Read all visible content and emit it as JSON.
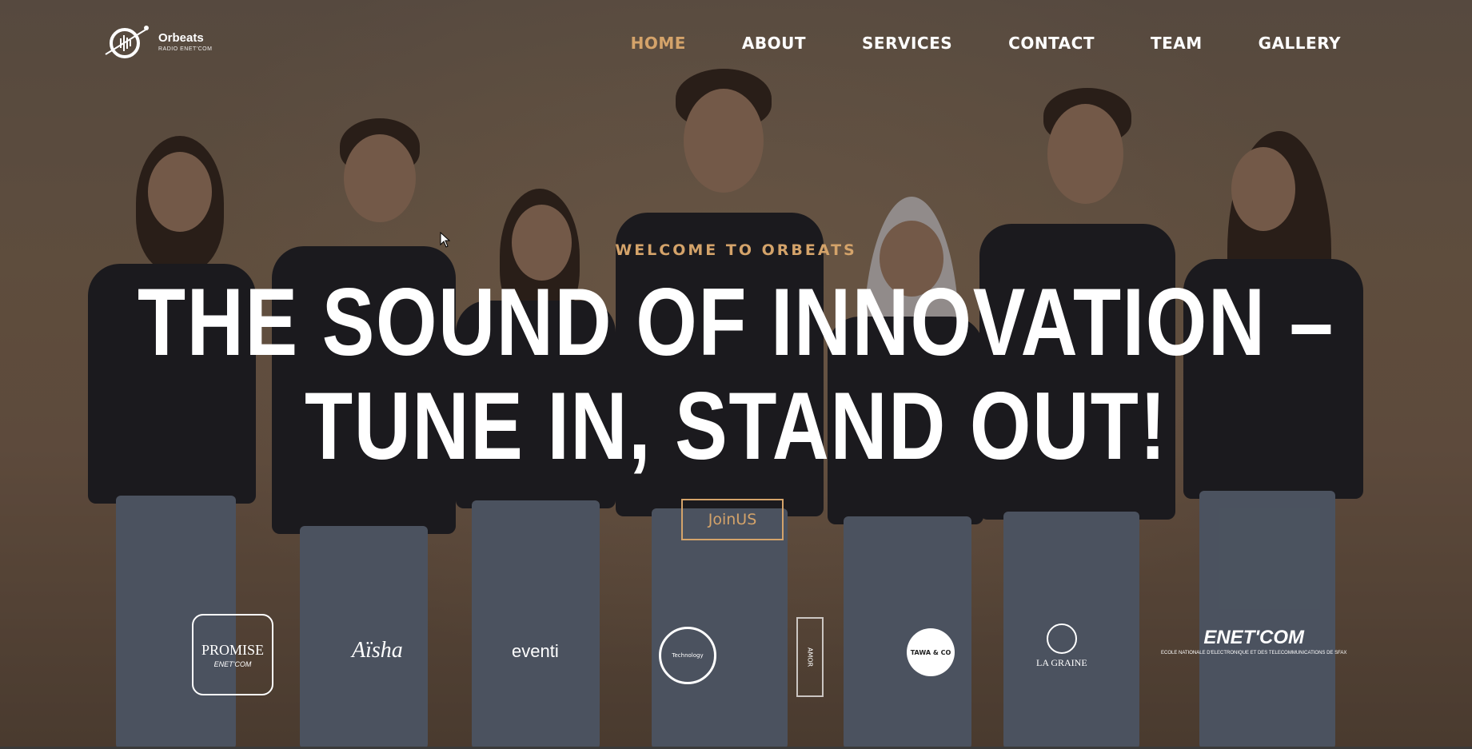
{
  "brand": {
    "name": "Orbeats",
    "sub": "RADIO ENET'COM"
  },
  "nav": {
    "items": [
      {
        "label": "HOME",
        "active": true
      },
      {
        "label": "ABOUT",
        "active": false
      },
      {
        "label": "SERVICES",
        "active": false
      },
      {
        "label": "CONTACT",
        "active": false
      },
      {
        "label": "TEAM",
        "active": false
      },
      {
        "label": "GALLERY",
        "active": false
      }
    ]
  },
  "hero": {
    "welcome": "WELCOME TO ORBEATS",
    "headline_line1": "THE SOUND OF INNOVATION –",
    "headline_line2": "TUNE IN, STAND OUT!",
    "cta_label": "JoinUS"
  },
  "sponsors": {
    "promise": {
      "name": "PROMISE",
      "sub": "ENET'COM"
    },
    "aisha": "Aïsha",
    "eventi": "eventi",
    "tech": "Technology",
    "vertical": "AMOR",
    "tawa": "TAWA & CO",
    "graine": "LA GRAINE",
    "enet": {
      "name": "ENET'COM",
      "sub": "ECOLE NATIONALE D'ELECTRONIQUE ET DES TELECOMMUNICATIONS DE SFAX"
    }
  },
  "colors": {
    "accent": "#d4a36a",
    "text": "#ffffff",
    "overlay": "#281e16"
  }
}
